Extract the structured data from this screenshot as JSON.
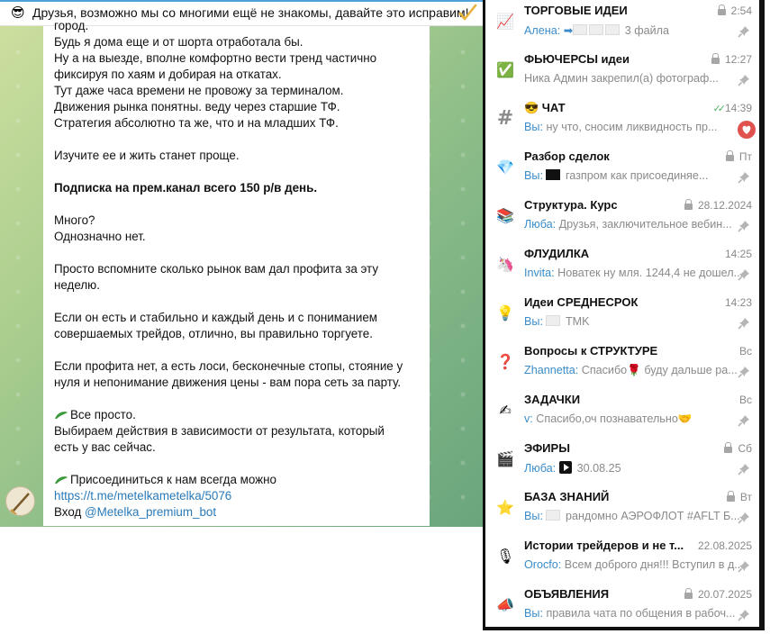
{
  "pinned": {
    "emoji": "😎",
    "text": "Друзья, возможно мы со многими ещё не знакомы,  давайте это исправим!"
  },
  "message": {
    "lines": [
      "город.",
      "Будь я  дома еще и от шорта отработала бы.",
      "Ну а на выезде, вполне комфортно вести тренд частично",
      "фиксируя по хаям  и добирая на откатах.",
      "Тут даже часа времени не провожу за терминалом.",
      "Движения рынка понятны. веду через старшие ТФ.",
      "Стратегия абсолютно та же, что и на младших ТФ.",
      "",
      "Изучите ее и жить станет проще.",
      "",
      "Подписка на прем.канал всего 150 р/в день.",
      "",
      "Много?",
      "Однозначно нет.",
      "",
      "Просто вспомните сколько рынок вам дал профита за эту",
      "неделю.",
      "",
      "Если он есть и стабильно и каждый день и с пониманием",
      "совершаемых трейдов, отлично, вы правильно торгуете.",
      "",
      "Если профита нет, а есть лоси, бесконечные стопы, стояние у",
      "нуля и непонимание движения цены - вам пора сеть за парту.",
      "",
      "Все просто.",
      "Выбираем действия в зависимости от результата, который",
      "есть у вас сейчас.",
      "",
      "Присоединиться  к нам всегда можно",
      "https://t.me/metelkametelka/5076",
      "Вход ",
      "@Metelka_premium_bot"
    ]
  },
  "chats": [
    {
      "icon": "📈",
      "name": "ТОРГОВЫЕ ИДЕИ",
      "time": "2:54",
      "sender": "Алена:",
      "preview": "3 файла",
      "locked": true,
      "pinned": true
    },
    {
      "icon": "✅",
      "name": "ФЬЮЧЕРСЫ идеи",
      "time": "12:27",
      "sender": "",
      "preview": "Ника Админ закрепил(а) фотограф...",
      "locked": true,
      "pinned": true
    },
    {
      "icon": "#",
      "name": "😎 ЧАТ",
      "time": "14:39",
      "sender": "Вы:",
      "preview": "ну что, сносим ликвидность пр...",
      "locked": false,
      "pinned": false
    },
    {
      "icon": "💎",
      "name": "Разбор сделок",
      "time": "Пт",
      "sender": "Вы:",
      "preview": "газпром  как присоединяе...",
      "locked": true,
      "pinned": true
    },
    {
      "icon": "📚",
      "name": "Структура. Курс",
      "time": "28.12.2024",
      "sender": "Люба:",
      "preview": "Друзья, заключительное вебин...",
      "locked": true,
      "pinned": true
    },
    {
      "icon": "🦄",
      "name": "ФЛУДИЛКА",
      "time": "14:25",
      "sender": "Invita:",
      "preview": "Новатек ну мля. 1244,4 не дошел...",
      "locked": false,
      "pinned": true
    },
    {
      "icon": "💡",
      "name": "Идеи СРЕДНЕСРОК",
      "time": "14:23",
      "sender": "Вы:",
      "preview": "TMK",
      "locked": false,
      "pinned": true
    },
    {
      "icon": "❓",
      "name": "Вопросы к СТРУКТУРЕ",
      "time": "Вс",
      "sender": "Zhannetta:",
      "preview": "Спасибо🌹 буду дальше ра...",
      "locked": false,
      "pinned": true
    },
    {
      "icon": "✍",
      "name": "ЗАДАЧКИ",
      "time": "Вс",
      "sender": "v:",
      "preview": "Спасибо,оч познавательно🤝",
      "locked": false,
      "pinned": true
    },
    {
      "icon": "🎬",
      "name": "ЭФИРЫ",
      "time": "Сб",
      "sender": "Люба:",
      "preview": "30.08.25",
      "locked": true,
      "pinned": true
    },
    {
      "icon": "⭐",
      "name": "БАЗА ЗНАНИЙ",
      "time": "Вт",
      "sender": "Вы:",
      "preview": "рандомно АЭРОФЛОТ #AFLT  Б...",
      "locked": true,
      "pinned": true
    },
    {
      "icon": "🎙",
      "name": "Истории трейдеров и не т...",
      "time": "22.08.2025",
      "sender": "Orocfo:",
      "preview": "Всем доброго дня!!! Вступил в д...",
      "locked": false,
      "pinned": true
    },
    {
      "icon": "📣",
      "name": "ОБЪЯВЛЕНИЯ",
      "time": "20.07.2025",
      "sender": "Вы:",
      "preview": "правила чата по общения в рабоч...",
      "locked": true,
      "pinned": true
    }
  ],
  "colors": {
    "accent": "#4fa1d8",
    "sender": "#3a8cc9",
    "link": "#2a7ab8",
    "read_checks": "#4cb163"
  }
}
